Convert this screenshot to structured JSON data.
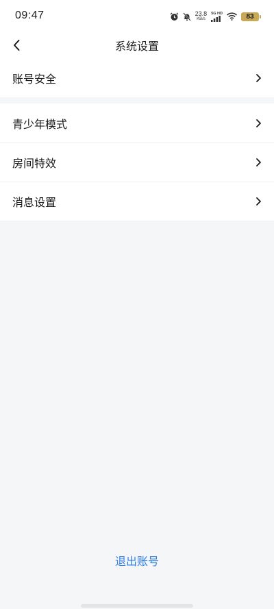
{
  "status_bar": {
    "time": "09:47",
    "net_speed_value": "23.8",
    "net_speed_unit": "KB/s",
    "signal_label": "5G HD",
    "battery_level": "83",
    "battery_color": "#c8a958"
  },
  "nav": {
    "title": "系统设置",
    "back_icon": "chevron-left-icon"
  },
  "settings": {
    "group1": [
      {
        "label": "账号安全"
      }
    ],
    "group2": [
      {
        "label": "青少年模式"
      },
      {
        "label": "房间特效"
      },
      {
        "label": "消息设置"
      }
    ]
  },
  "footer": {
    "logout_label": "退出账号",
    "logout_color": "#2f7fe8"
  }
}
